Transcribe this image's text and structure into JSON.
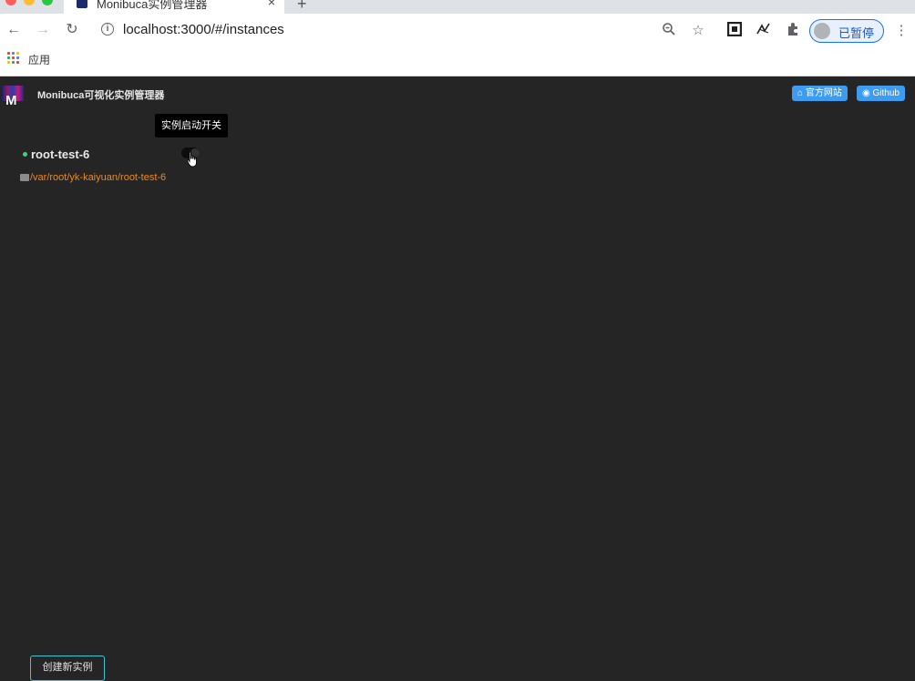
{
  "browser": {
    "tab_title": "Monibuca实例管理器",
    "tab_close_icon": "×",
    "new_tab_icon": "+",
    "url": "localhost:3000/#/instances",
    "profile_label": "已暂停",
    "bookmarks_apps_label": "应用"
  },
  "app": {
    "logo_text": "M",
    "title": "Monibuca可视化实例管理器",
    "header_buttons": {
      "website": "官方网站",
      "github": "Github"
    },
    "tooltip": "实例启动开关",
    "instance": {
      "name": "root-test-6",
      "path": "/var/root/yk-kaiyuan/root-test-6",
      "status": "running",
      "switch_on": true
    },
    "create_button": "创建新实例"
  },
  "colors": {
    "app_bg": "#252525",
    "accent_blue": "#3d9cf0",
    "status_green": "#3cd47a",
    "path_orange": "#f0891b",
    "create_border": "#3ec6d6"
  }
}
